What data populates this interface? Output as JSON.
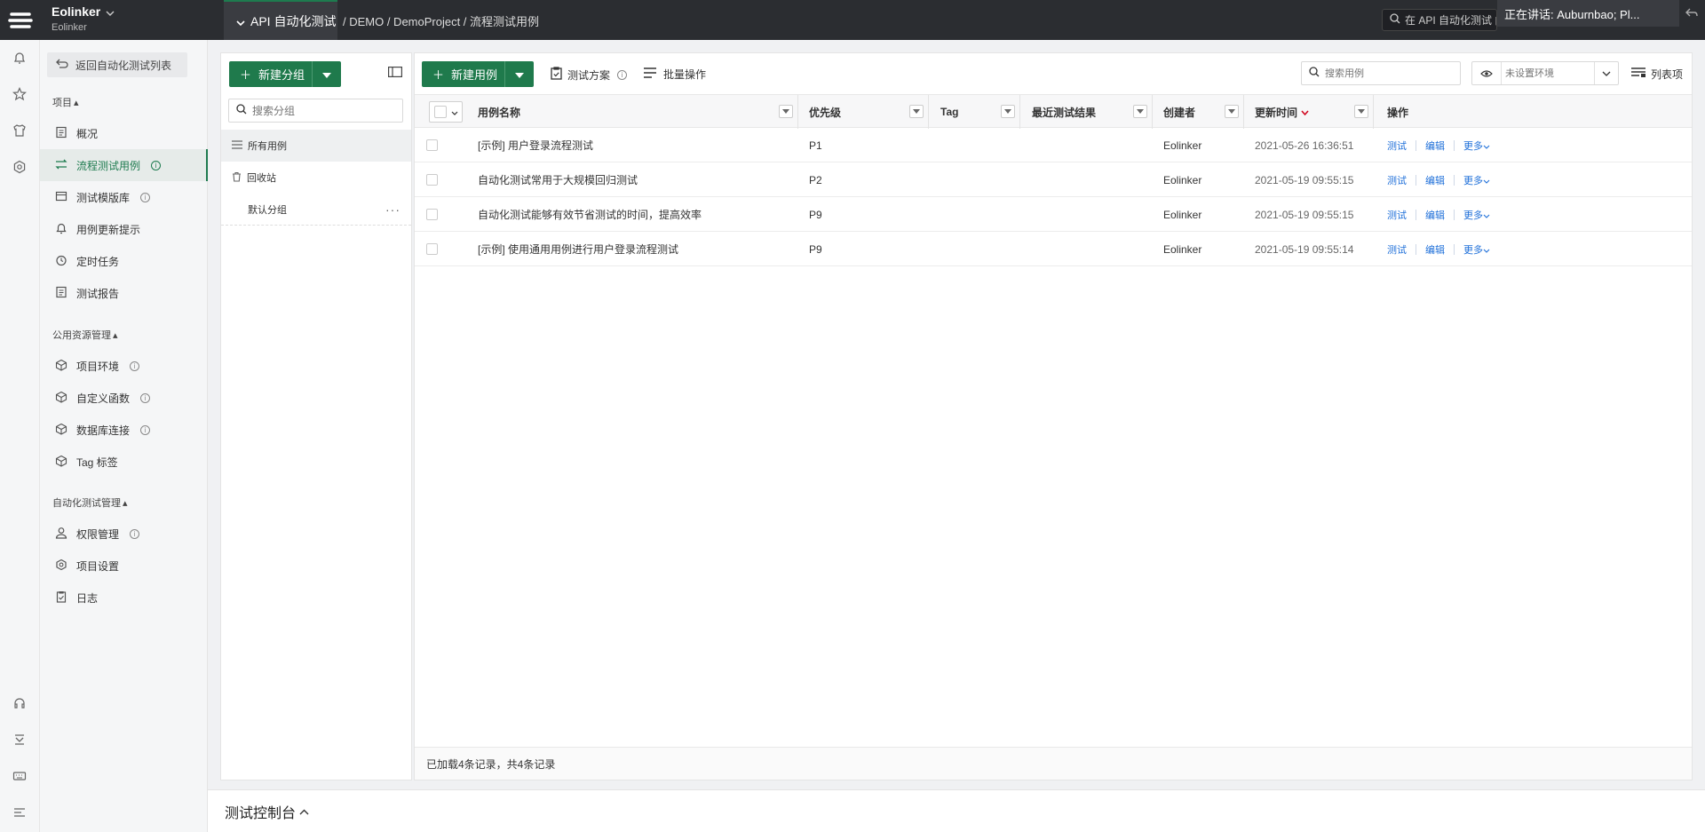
{
  "topbar": {
    "org_name": "Eolinker",
    "org_sub": "Eolinker",
    "module_tab": "API 自动化测试",
    "breadcrumb": "/ DEMO / DemoProject / 流程测试用例",
    "search_placeholder": "在 API 自动化测试 内",
    "speaking": "正在讲话: Auburnbao; Pl..."
  },
  "sidebar": {
    "back_label": "返回自动化测试列表",
    "section_project": "项目",
    "project_items": [
      {
        "label": "概况"
      },
      {
        "label": "流程测试用例"
      },
      {
        "label": "测试模版库"
      },
      {
        "label": "用例更新提示"
      },
      {
        "label": "定时任务"
      },
      {
        "label": "测试报告"
      }
    ],
    "section_resource": "公用资源管理",
    "resource_items": [
      {
        "label": "项目环境"
      },
      {
        "label": "自定义函数"
      },
      {
        "label": "数据库连接"
      },
      {
        "label": "Tag 标签"
      }
    ],
    "section_auto": "自动化测试管理",
    "auto_items": [
      {
        "label": "权限管理"
      },
      {
        "label": "项目设置"
      },
      {
        "label": "日志"
      }
    ]
  },
  "groups": {
    "new_group_label": "新建分组",
    "search_placeholder": "搜索分组",
    "items": [
      {
        "label": "所有用例"
      },
      {
        "label": "回收站"
      },
      {
        "label": "默认分组"
      }
    ]
  },
  "toolbar": {
    "new_case_label": "新建用例",
    "test_plan_label": "测试方案",
    "batch_label": "批量操作",
    "search_placeholder": "搜索用例",
    "env_placeholder": "未设置环境",
    "columns_label": "列表项"
  },
  "table": {
    "headers": {
      "name": "用例名称",
      "priority": "优先级",
      "tag": "Tag",
      "result": "最近测试结果",
      "creator": "创建者",
      "updated": "更新时间",
      "ops": "操作"
    },
    "rows": [
      {
        "name": "[示例] 用户登录流程测试",
        "priority": "P1",
        "tag": "",
        "result": "",
        "creator": "Eolinker",
        "updated": "2021-05-26 16:36:51"
      },
      {
        "name": "自动化测试常用于大规模回归测试",
        "priority": "P2",
        "tag": "",
        "result": "",
        "creator": "Eolinker",
        "updated": "2021-05-19 09:55:15"
      },
      {
        "name": "自动化测试能够有效节省测试的时间，提高效率",
        "priority": "P9",
        "tag": "",
        "result": "",
        "creator": "Eolinker",
        "updated": "2021-05-19 09:55:15"
      },
      {
        "name": "[示例] 使用通用用例进行用户登录流程测试",
        "priority": "P9",
        "tag": "",
        "result": "",
        "creator": "Eolinker",
        "updated": "2021-05-19 09:55:14"
      }
    ],
    "op_test": "测试",
    "op_edit": "编辑",
    "op_more": "更多",
    "footer": "已加载4条记录，共4条记录"
  },
  "console": {
    "label": "测试控制台"
  },
  "colors": {
    "brand_green": "#1f7a4c",
    "link_blue": "#1e6fd9",
    "topbar": "#2b2d31"
  }
}
